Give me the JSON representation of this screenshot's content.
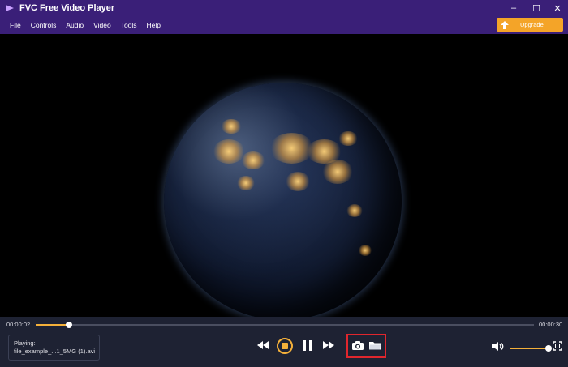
{
  "window": {
    "title": "FVC Free Video Player",
    "controls": {
      "minimize": "–",
      "maximize": "☐",
      "close": "✕"
    }
  },
  "menu": {
    "items": [
      "File",
      "Controls",
      "Audio",
      "Video",
      "Tools",
      "Help"
    ],
    "upgrade_label": "Upgrade"
  },
  "player": {
    "current_time": "00:00:02",
    "total_time": "00:00:30",
    "progress": 0.066,
    "volume": 0.92,
    "now_playing_label": "Playing:",
    "file_name": "file_example_...1_5MG (1).avi"
  },
  "icons": {
    "app": "play-logo-icon",
    "upgrade": "upload-arrow-icon",
    "rewind": "rewind-icon",
    "stop": "stop-icon",
    "pause": "pause-icon",
    "forward": "fast-forward-icon",
    "snapshot": "camera-icon",
    "folder": "folder-icon",
    "volume": "speaker-icon",
    "fullscreen": "fullscreen-icon"
  },
  "colors": {
    "titlebar": "#3a1f78",
    "accent": "#f4b03a",
    "upgrade": "#f4a428",
    "controlbar": "#1e2233",
    "highlight": "#e0262d"
  }
}
